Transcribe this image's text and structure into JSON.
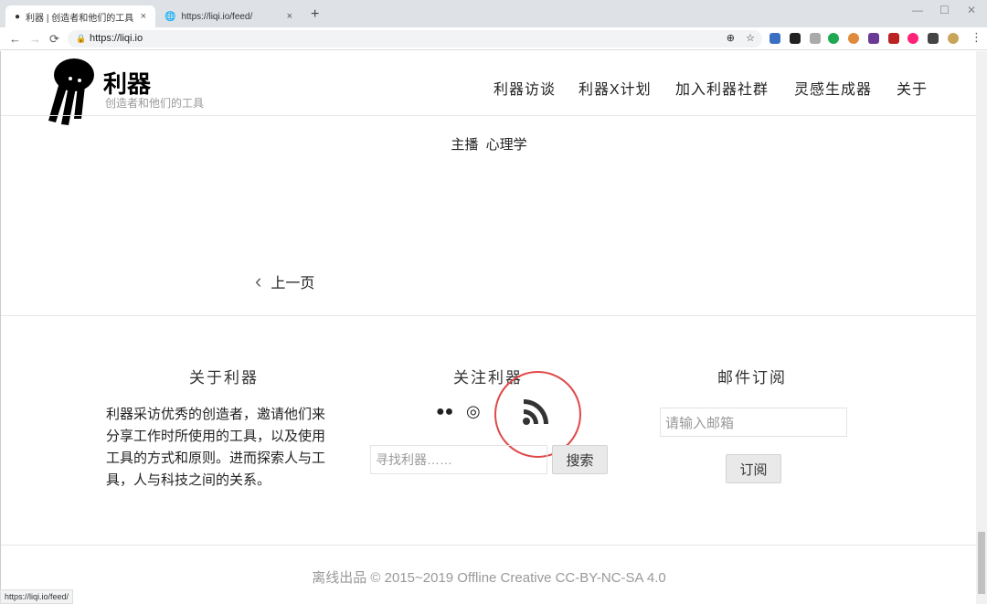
{
  "browser": {
    "tabs": [
      {
        "label": "利器 | 创造者和他们的工具",
        "close": "×"
      },
      {
        "label": "https://liqi.io/feed/",
        "close": "×"
      }
    ],
    "new_tab": "+",
    "url": "https://liqi.io",
    "status_url": "https://liqi.io/feed/"
  },
  "header": {
    "title": "利器",
    "subtitle": "创造者和他们的工具",
    "menu": [
      "利器访谈",
      "利器X计划",
      "加入利器社群",
      "灵感生成器",
      "关于"
    ]
  },
  "content": {
    "tags": "主播  心理学",
    "prev_page": "上一页"
  },
  "footer": {
    "about": {
      "heading": "关于利器",
      "text": "利器采访优秀的创造者，邀请他们来分享工作时所使用的工具，以及使用工具的方式和原则。进而探索人与工具，人与科技之间的关系。"
    },
    "follow": {
      "heading": "关注利器",
      "search_placeholder": "寻找利器……",
      "search_button": "搜索"
    },
    "subscribe": {
      "heading": "邮件订阅",
      "email_placeholder": "请输入邮箱",
      "button": "订阅"
    },
    "copyright": "离线出品 © 2015~2019 Offline Creative CC-BY-NC-SA 4.0"
  }
}
